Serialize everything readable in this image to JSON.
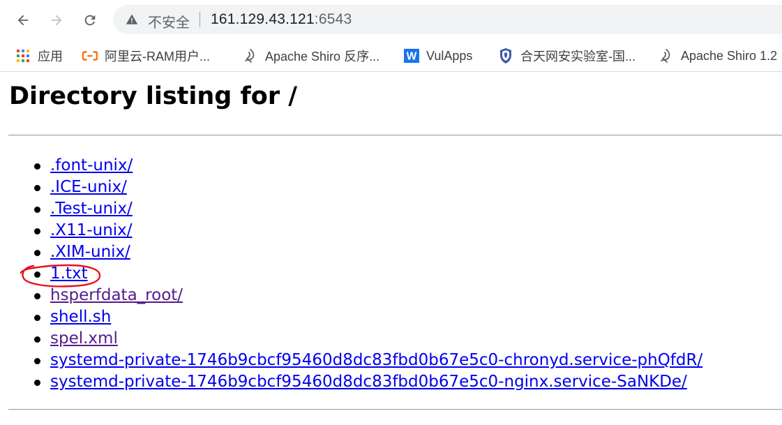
{
  "browser": {
    "security_label": "不安全",
    "url_host": "161.129.43.121",
    "url_port": ":6543"
  },
  "bookmarks": [
    {
      "label": "应用",
      "icon": "apps-grid-icon"
    },
    {
      "label": "阿里云-RAM用户...",
      "icon": "aliyun-icon"
    },
    {
      "label": "Apache Shiro 反序...",
      "icon": "bookmark-site-icon"
    },
    {
      "label": "VulApps",
      "icon": "vulapps-w-icon"
    },
    {
      "label": "合天网安实验室-国...",
      "icon": "shield-icon"
    },
    {
      "label": "Apache Shiro 1.2",
      "icon": "bookmark-site-icon"
    }
  ],
  "page": {
    "title": "Directory listing for /",
    "entries": [
      {
        "name": ".font-unix/",
        "visited": false
      },
      {
        "name": ".ICE-unix/",
        "visited": false
      },
      {
        "name": ".Test-unix/",
        "visited": false
      },
      {
        "name": ".X11-unix/",
        "visited": false
      },
      {
        "name": ".XIM-unix/",
        "visited": false
      },
      {
        "name": "1.txt",
        "visited": false
      },
      {
        "name": "hsperfdata_root/",
        "visited": true
      },
      {
        "name": "shell.sh",
        "visited": false
      },
      {
        "name": "spel.xml",
        "visited": true
      },
      {
        "name": "systemd-private-1746b9cbcf95460d8dc83fbd0b67e5c0-chronyd.service-phQfdR/",
        "visited": false
      },
      {
        "name": "systemd-private-1746b9cbcf95460d8dc83fbd0b67e5c0-nginx.service-SaNKDe/",
        "visited": false
      }
    ]
  },
  "colors": {
    "link": "#0000ee",
    "visited_link": "#551a8b",
    "annotation": "#e8101c"
  }
}
